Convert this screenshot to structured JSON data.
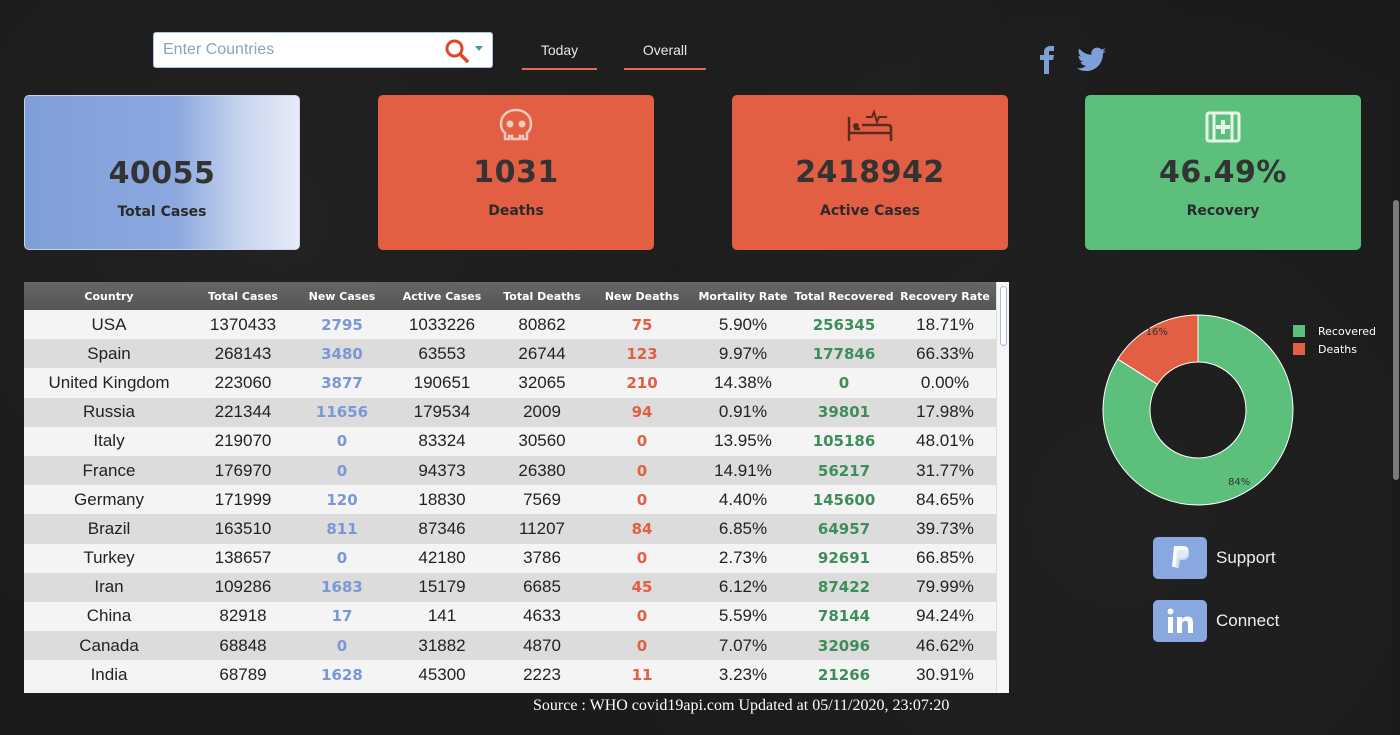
{
  "search": {
    "placeholder": "Enter Countries"
  },
  "tabs": [
    {
      "label": "Today"
    },
    {
      "label": "Overall"
    }
  ],
  "social": {
    "facebook_icon": "facebook-icon",
    "twitter_icon": "twitter-icon"
  },
  "cards": {
    "total": {
      "value": "40055",
      "label": "Total Cases",
      "color": "#8aa8e0"
    },
    "deaths": {
      "value": "1031",
      "label": "Deaths",
      "icon": "skull-icon",
      "color": "#e35f44"
    },
    "active": {
      "value": "2418942",
      "label": "Active Cases",
      "icon": "hospital-bed-icon",
      "color": "#e35f44"
    },
    "recovery": {
      "value": "46.49%",
      "label": "Recovery",
      "icon": "first-aid-kit-icon",
      "color": "#5cbf7c"
    }
  },
  "table": {
    "headers": [
      "Country",
      "Total Cases",
      "New Cases",
      "Active Cases",
      "Total Deaths",
      "New Deaths",
      "Mortality Rate",
      "Total Recovered",
      "Recovery Rate"
    ],
    "rows": [
      [
        "USA",
        "1370433",
        "2795",
        "1033226",
        "80862",
        "75",
        "5.90%",
        "256345",
        "18.71%"
      ],
      [
        "Spain",
        "268143",
        "3480",
        "63553",
        "26744",
        "123",
        "9.97%",
        "177846",
        "66.33%"
      ],
      [
        "United Kingdom",
        "223060",
        "3877",
        "190651",
        "32065",
        "210",
        "14.38%",
        "0",
        "0.00%"
      ],
      [
        "Russia",
        "221344",
        "11656",
        "179534",
        "2009",
        "94",
        "0.91%",
        "39801",
        "17.98%"
      ],
      [
        "Italy",
        "219070",
        "0",
        "83324",
        "30560",
        "0",
        "13.95%",
        "105186",
        "48.01%"
      ],
      [
        "France",
        "176970",
        "0",
        "94373",
        "26380",
        "0",
        "14.91%",
        "56217",
        "31.77%"
      ],
      [
        "Germany",
        "171999",
        "120",
        "18830",
        "7569",
        "0",
        "4.40%",
        "145600",
        "84.65%"
      ],
      [
        "Brazil",
        "163510",
        "811",
        "87346",
        "11207",
        "84",
        "6.85%",
        "64957",
        "39.73%"
      ],
      [
        "Turkey",
        "138657",
        "0",
        "42180",
        "3786",
        "0",
        "2.73%",
        "92691",
        "66.85%"
      ],
      [
        "Iran",
        "109286",
        "1683",
        "15179",
        "6685",
        "45",
        "6.12%",
        "87422",
        "79.99%"
      ],
      [
        "China",
        "82918",
        "17",
        "141",
        "4633",
        "0",
        "5.59%",
        "78144",
        "94.24%"
      ],
      [
        "Canada",
        "68848",
        "0",
        "31882",
        "4870",
        "0",
        "7.07%",
        "32096",
        "46.62%"
      ],
      [
        "India",
        "68789",
        "1628",
        "45300",
        "2223",
        "11",
        "3.23%",
        "21266",
        "30.91%"
      ]
    ]
  },
  "source_text": "Source : WHO covid19api.com Updated at 05/11/2020, 23:07:20",
  "chart_data": {
    "type": "pie",
    "categories": [
      "Recovered",
      "Deaths"
    ],
    "values": [
      84,
      16
    ],
    "data_labels": [
      "84%",
      "16%"
    ],
    "colors": [
      "#5cbf7c",
      "#e35f44"
    ],
    "legend_position": "top-right"
  },
  "side_buttons": [
    {
      "label": "Support",
      "icon": "paypal-icon"
    },
    {
      "label": "Connect",
      "icon": "linkedin-icon"
    }
  ]
}
